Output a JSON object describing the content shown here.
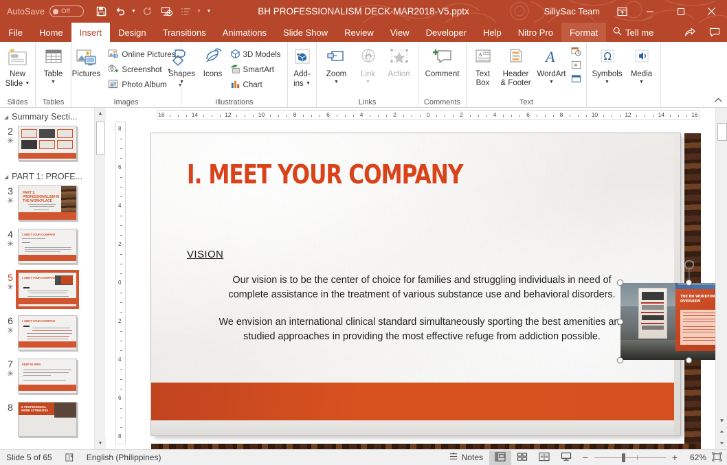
{
  "titlebar": {
    "autosave_label": "AutoSave",
    "autosave_state": "Off",
    "document_title": "BH PROFESSIONALISM DECK-MAR2018-V5.pptx",
    "team_name": "SillySac Team",
    "qat": [
      {
        "name": "save-button",
        "glyph": "save-icon"
      },
      {
        "name": "undo-button",
        "glyph": "undo-icon"
      },
      {
        "name": "redo-button",
        "glyph": "redo-icon"
      },
      {
        "name": "start-from-beginning-button",
        "glyph": "slideshow-icon"
      },
      {
        "name": "custom-order-button",
        "glyph": "list-icon"
      }
    ],
    "window_controls": {
      "ribbon_display": "ribbon-display-options",
      "minimize": "–",
      "maximize": "□",
      "close": "✕"
    }
  },
  "tabs": [
    {
      "label": "File",
      "state": "normal"
    },
    {
      "label": "Home",
      "state": "normal"
    },
    {
      "label": "Insert",
      "state": "active"
    },
    {
      "label": "Design",
      "state": "normal"
    },
    {
      "label": "Transitions",
      "state": "normal"
    },
    {
      "label": "Animations",
      "state": "normal"
    },
    {
      "label": "Slide Show",
      "state": "normal"
    },
    {
      "label": "Review",
      "state": "normal"
    },
    {
      "label": "View",
      "state": "normal"
    },
    {
      "label": "Developer",
      "state": "normal"
    },
    {
      "label": "Help",
      "state": "normal"
    },
    {
      "label": "Nitro Pro",
      "state": "normal"
    },
    {
      "label": "Format",
      "state": "contextual"
    }
  ],
  "tellme": {
    "label": "Tell me",
    "icon": "search-icon"
  },
  "tab_right_icons": [
    {
      "name": "share-icon"
    },
    {
      "name": "comments-icon"
    }
  ],
  "ribbon": {
    "groups": [
      {
        "label": "Slides",
        "big": [
          {
            "label": "New\nSlide",
            "name": "new-slide-button",
            "caret": true,
            "icon": "new-slide-icon"
          }
        ]
      },
      {
        "label": "Tables",
        "big": [
          {
            "label": "Table",
            "name": "table-button",
            "caret": true,
            "icon": "table-icon"
          }
        ]
      },
      {
        "label": "Images",
        "big": [
          {
            "label": "Pictures",
            "name": "pictures-button",
            "caret": false,
            "icon": "pictures-icon"
          }
        ],
        "small": [
          {
            "label": "Online Pictures",
            "name": "online-pictures-button",
            "caret": false,
            "icon": "online-pictures-icon"
          },
          {
            "label": "Screenshot",
            "name": "screenshot-button",
            "caret": true,
            "icon": "screenshot-icon"
          },
          {
            "label": "Photo Album",
            "name": "photo-album-button",
            "caret": true,
            "icon": "photo-album-icon"
          }
        ]
      },
      {
        "label": "Illustrations",
        "big": [
          {
            "label": "Shapes",
            "name": "shapes-button",
            "caret": true,
            "icon": "shapes-icon"
          },
          {
            "label": "Icons",
            "name": "icons-button",
            "caret": false,
            "icon": "icons-icon"
          }
        ],
        "small": [
          {
            "label": "3D Models",
            "name": "three-d-models-button",
            "caret": true,
            "icon": "3d-model-icon"
          },
          {
            "label": "SmartArt",
            "name": "smartart-button",
            "caret": false,
            "icon": "smartart-icon"
          },
          {
            "label": "Chart",
            "name": "chart-button",
            "caret": false,
            "icon": "chart-icon"
          }
        ]
      },
      {
        "label": "",
        "big": [
          {
            "label": "Add-\nins",
            "name": "add-ins-button",
            "caret": true,
            "icon": "addins-icon"
          }
        ]
      },
      {
        "label": "Links",
        "big": [
          {
            "label": "Zoom",
            "name": "zoom-button",
            "caret": true,
            "icon": "zoom-icon"
          },
          {
            "label": "Link",
            "name": "link-button",
            "caret": true,
            "icon": "link-icon",
            "disabled": true
          },
          {
            "label": "Action",
            "name": "action-button",
            "caret": false,
            "icon": "action-icon",
            "disabled": true
          }
        ]
      },
      {
        "label": "Comments",
        "big": [
          {
            "label": "Comment",
            "name": "comment-button",
            "caret": false,
            "icon": "comment-icon"
          }
        ]
      },
      {
        "label": "Text",
        "big": [
          {
            "label": "Text\nBox",
            "name": "text-box-button",
            "caret": false,
            "icon": "text-box-icon"
          },
          {
            "label": "Header\n& Footer",
            "name": "header-footer-button",
            "caret": false,
            "icon": "header-footer-icon"
          },
          {
            "label": "WordArt",
            "name": "wordart-button",
            "caret": true,
            "icon": "wordart-icon"
          }
        ],
        "stack": [
          {
            "name": "date-time-button",
            "icon": "date-time-icon"
          },
          {
            "name": "slide-number-button",
            "icon": "slide-number-icon"
          },
          {
            "name": "object-button",
            "icon": "object-icon"
          }
        ]
      },
      {
        "label": "",
        "big": [
          {
            "label": "Symbols",
            "name": "symbols-button",
            "caret": true,
            "icon": "omega-icon"
          },
          {
            "label": "Media",
            "name": "media-button",
            "caret": true,
            "icon": "media-icon"
          }
        ]
      }
    ],
    "collapse_label": "collapse-ribbon-icon"
  },
  "thumbnails": {
    "sections": [
      {
        "title": "Summary Secti...",
        "collapsed": false
      },
      {
        "title": "PART 1: PROFE...",
        "collapsed": false
      }
    ],
    "slides": [
      {
        "number": "2",
        "star": "✳",
        "selected": false,
        "kind": "grid",
        "section": 0
      },
      {
        "number": "3",
        "star": "✳",
        "selected": false,
        "kind": "part-title",
        "section": 1,
        "title": "PART 1: PROFESSIONALISM IN THE WORKPLACE"
      },
      {
        "number": "4",
        "star": "✳",
        "selected": false,
        "kind": "text",
        "section": 1,
        "title": "I. MEET YOUR COMPANY"
      },
      {
        "number": "5",
        "star": "✳",
        "selected": true,
        "kind": "text-image",
        "section": 1,
        "title": "I. MEET YOUR COMPANY"
      },
      {
        "number": "6",
        "star": "✳",
        "selected": false,
        "kind": "text-lines",
        "section": 1,
        "title": "I. MEET YOUR COMPANY"
      },
      {
        "number": "7",
        "star": "✳",
        "selected": false,
        "kind": "text",
        "section": 1,
        "title": "KEEP IN MIND"
      },
      {
        "number": "8",
        "star": "",
        "selected": false,
        "kind": "banner",
        "section": 1,
        "title": "II. PROFESSIONAL WORK ATTRIBUTES"
      }
    ]
  },
  "rulers": {
    "horizontal_ticks": [
      "16",
      "14",
      "12",
      "10",
      "8",
      "6",
      "4",
      "2",
      "0",
      "2",
      "4",
      "6",
      "8",
      "10",
      "12",
      "14",
      "16"
    ],
    "vertical_ticks": [
      "8",
      "6",
      "4",
      "2",
      "0",
      "2",
      "4",
      "6",
      "8"
    ]
  },
  "slide": {
    "title": "I. MEET YOUR COMPANY",
    "section_label": "VISION",
    "paragraphs": [
      "Our vision is to be the center of choice for families and struggling individuals in need of complete assistance in the treatment of various substance use and behavioral disorders.",
      "We envision an international clinical standard simultaneously sporting the best amenities and studied approaches in providing the most effective refuge from addiction possible."
    ],
    "picture": {
      "name": "bh-workforce-screenshot",
      "overlay_title": "THE BH WORKFORCE: SHORT OVERVIEW",
      "selected": true
    },
    "accent_color": "#d8431a",
    "bar_color": "#d4511f"
  },
  "statusbar": {
    "slide_counter": "Slide 5 of 65",
    "spellcheck_icon": "spellcheck-icon",
    "language": "English (Philippines)",
    "notes_label": "Notes",
    "views": [
      {
        "name": "normal-view-button",
        "icon": "normal-view-icon",
        "active": true
      },
      {
        "name": "slide-sorter-button",
        "icon": "slide-sorter-icon",
        "active": false
      },
      {
        "name": "reading-view-button",
        "icon": "reading-view-icon",
        "active": false
      },
      {
        "name": "slide-show-button",
        "icon": "slide-show-icon",
        "active": false
      }
    ],
    "zoom_out": "−",
    "zoom_in": "+",
    "zoom_percent": "62%",
    "fit_slide_icon": "fit-to-window-icon"
  }
}
